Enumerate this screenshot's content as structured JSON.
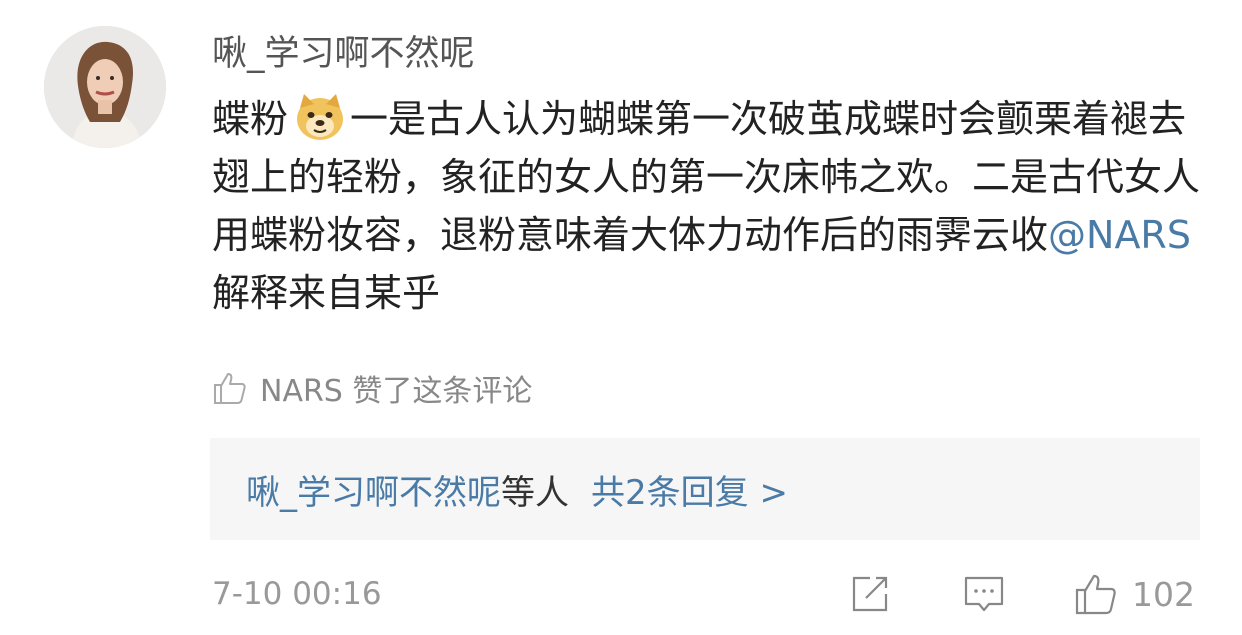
{
  "comment": {
    "username": "啾_学习啊不然呢",
    "avatar_icon": "user-avatar-photo",
    "text_before_emoji": "蝶粉",
    "emoji_icon": "doge-emoji",
    "text_after_emoji": "一是古人认为蝴蝶第一次破茧成蝶时会颤栗着褪去翅上的轻粉，象征的女人的第一次床帏之欢。二是古代女人用蝶粉妆容，退粉意味着大体力动作后的雨霁云收",
    "mention": "@NARS",
    "text_after_mention": " 解释来自某乎",
    "liked_by": "NARS 赞了这条评论",
    "replies": {
      "who": "啾_学习啊不然呢",
      "etc": "等人",
      "count": "共2条回复 >"
    },
    "time": "7-10 00:16",
    "like_count": "102"
  },
  "colors": {
    "link": "#4a7aa6",
    "meta": "#999999",
    "reply_bg": "#f6f6f6"
  }
}
